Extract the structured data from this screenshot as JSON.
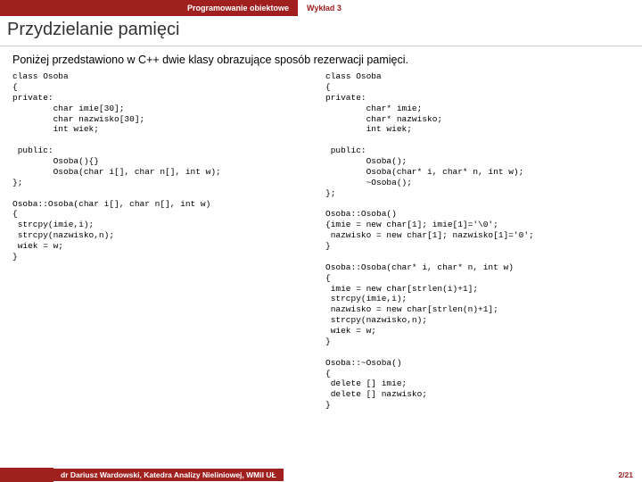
{
  "header": {
    "course": "Programowanie obiektowe",
    "lecture": "Wykład 3"
  },
  "title": "Przydzielanie pamięci",
  "intro": "Poniżej przedstawiono w C++ dwie klasy obrazujące sposób rezerwacji pamięci.",
  "code_left": "class Osoba\n{\nprivate:\n        char imie[30];\n        char nazwisko[30];\n        int wiek;\n\n public:\n        Osoba(){}\n        Osoba(char i[], char n[], int w);\n};\n\nOsoba::Osoba(char i[], char n[], int w)\n{\n strcpy(imie,i);\n strcpy(nazwisko,n);\n wiek = w;\n}",
  "code_right": "class Osoba\n{\nprivate:\n        char* imie;\n        char* nazwisko;\n        int wiek;\n\n public:\n        Osoba();\n        Osoba(char* i, char* n, int w);\n        ~Osoba();\n};\n\nOsoba::Osoba()\n{imie = new char[1]; imie[1]='\\0';\n nazwisko = new char[1]; nazwisko[1]='0';\n}\n\nOsoba::Osoba(char* i, char* n, int w)\n{\n imie = new char[strlen(i)+1];\n strcpy(imie,i);\n nazwisko = new char[strlen(n)+1];\n strcpy(nazwisko,n);\n wiek = w;\n}\n\nOsoba::~Osoba()\n{\n delete [] imie;\n delete [] nazwisko;\n}",
  "footer": {
    "author": "dr Dariusz Wardowski, Katedra Analizy Nieliniowej, WMiI UŁ",
    "page": "2/21"
  }
}
